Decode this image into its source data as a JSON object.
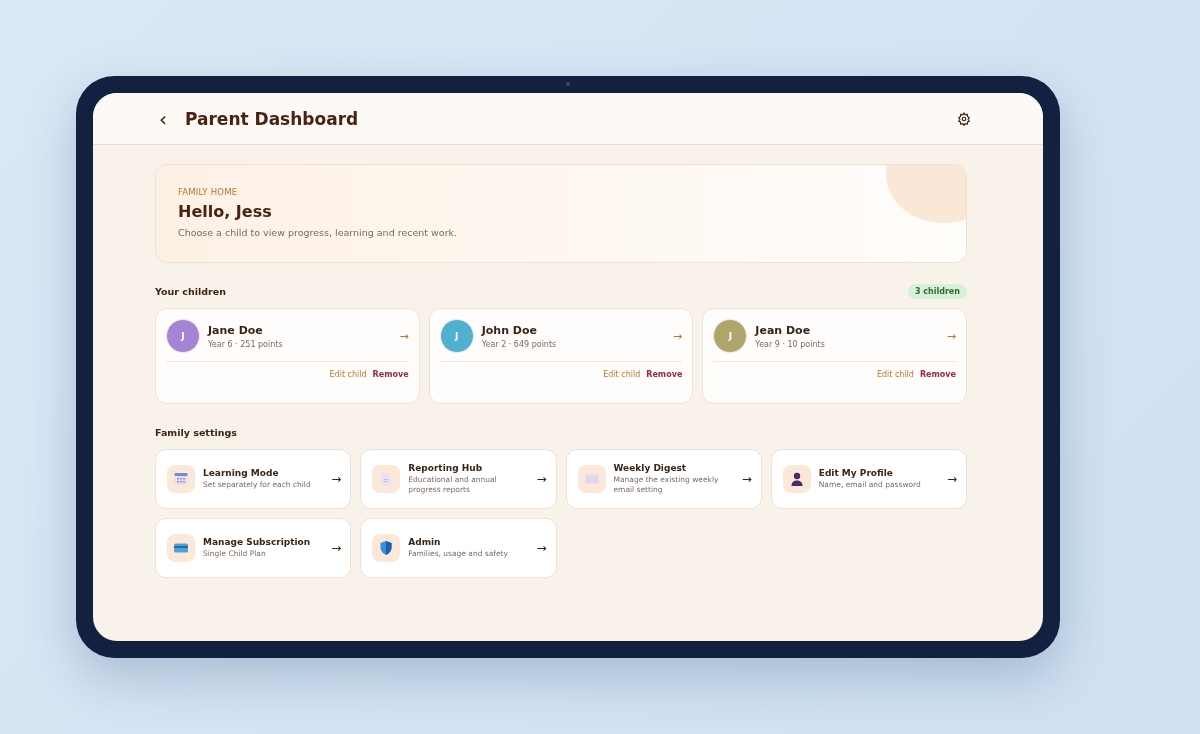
{
  "header": {
    "back": "‹",
    "title": "Parent Dashboard"
  },
  "welcome": {
    "eyebrow": "FAMILY HOME",
    "greeting": "Hello, Jess",
    "subtitle": "Choose a child to view progress, learning and recent work."
  },
  "children_section": {
    "title": "Your children",
    "count": "3 children"
  },
  "children": [
    {
      "initial": "J",
      "name": "Jane Doe",
      "details": "Year 6 · 251 points",
      "color": "#a584d6",
      "arrow": "→",
      "edit": "Edit child",
      "remove": "Remove"
    },
    {
      "initial": "J",
      "name": "John Doe",
      "details": "Year 2 · 649 points",
      "color": "#4fb0cf",
      "arrow": "→",
      "edit": "Edit child",
      "remove": "Remove"
    },
    {
      "initial": "J",
      "name": "Jean Doe",
      "details": "Year 9 · 10 points",
      "color": "#b0a56a",
      "arrow": "→",
      "edit": "Edit child",
      "remove": "Remove"
    }
  ],
  "settings_section": {
    "title": "Family settings"
  },
  "settings": [
    {
      "title": "Learning Mode",
      "subtitle": "Set separately for each child",
      "arrow": "→"
    },
    {
      "title": "Reporting Hub",
      "subtitle": "Educational and annual progress reports",
      "arrow": "→"
    },
    {
      "title": "Weekly Digest",
      "subtitle": "Manage the existing weekly email setting",
      "arrow": "→"
    },
    {
      "title": "Edit My Profile",
      "subtitle": "Name, email and password",
      "arrow": "→"
    },
    {
      "title": "Manage Subscription",
      "subtitle": "Single Child Plan",
      "arrow": "→"
    },
    {
      "title": "Admin",
      "subtitle": "Families, usage and safety",
      "arrow": "→"
    }
  ]
}
